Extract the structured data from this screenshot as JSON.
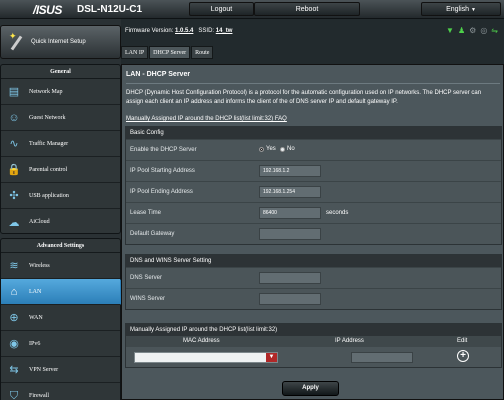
{
  "header": {
    "logo": "/ISUS",
    "model": "DSL-N12U-C1",
    "logout_label": "Logout",
    "reboot_label": "Reboot",
    "language": "English"
  },
  "sidebar": {
    "quick_setup": "Quick Internet Setup",
    "general_title": "General",
    "general_items": [
      {
        "label": "Network Map",
        "icon": "network-map-icon"
      },
      {
        "label": "Guest Network",
        "icon": "guest-network-icon"
      },
      {
        "label": "Traffic Manager",
        "icon": "traffic-manager-icon"
      },
      {
        "label": "Parental control",
        "icon": "parental-control-icon"
      },
      {
        "label": "USB application",
        "icon": "usb-icon"
      },
      {
        "label": "AiCloud",
        "icon": "cloud-icon"
      }
    ],
    "advanced_title": "Advanced Settings",
    "advanced_items": [
      {
        "label": "Wireless",
        "icon": "wireless-icon"
      },
      {
        "label": "LAN",
        "icon": "lan-icon"
      },
      {
        "label": "WAN",
        "icon": "globe-icon"
      },
      {
        "label": "IPv6",
        "icon": "ipv6-icon"
      },
      {
        "label": "VPN Server",
        "icon": "vpn-icon"
      },
      {
        "label": "Firewall",
        "icon": "firewall-icon"
      }
    ]
  },
  "firmware": {
    "version_label": "Firmware Version:",
    "version": "1.0.5.4",
    "ssid_label": "SSID:",
    "ssid": "14_tw"
  },
  "tabs": [
    "LAN IP",
    "DHCP Server",
    "Route"
  ],
  "page": {
    "title": "LAN - DHCP Server",
    "description": "DHCP (Dynamic Host Configuration Protocol) is a protocol for the automatic configuration used on IP networks. The DHCP server can assign each client an IP address and informs the client of the of DNS server IP and default gateway IP.",
    "faq_link": "Manually Assigned IP around the DHCP list(list limit:32) FAQ"
  },
  "basic_config": {
    "title": "Basic Config",
    "enable_label": "Enable the DHCP Server",
    "yes_label": "Yes",
    "no_label": "No",
    "start_label": "IP Pool Starting Address",
    "start_value": "192.168.1.2",
    "end_label": "IP Pool Ending Address",
    "end_value": "192.168.1.254",
    "lease_label": "Lease Time",
    "lease_value": "86400",
    "lease_unit": "seconds",
    "gateway_label": "Default Gateway",
    "gateway_value": ""
  },
  "dns_wins": {
    "title": "DNS and WINS Server Setting",
    "dns_label": "DNS Server",
    "dns_value": "",
    "wins_label": "WINS Server",
    "wins_value": ""
  },
  "manual_list": {
    "title": "Manually Assigned IP around the DHCP list(list limit:32)",
    "col_mac": "MAC Address",
    "col_ip": "IP Address",
    "col_edit": "Edit"
  },
  "apply_label": "Apply",
  "colors": {
    "accent": "#2c7fb8",
    "panel": "#4c575c"
  }
}
